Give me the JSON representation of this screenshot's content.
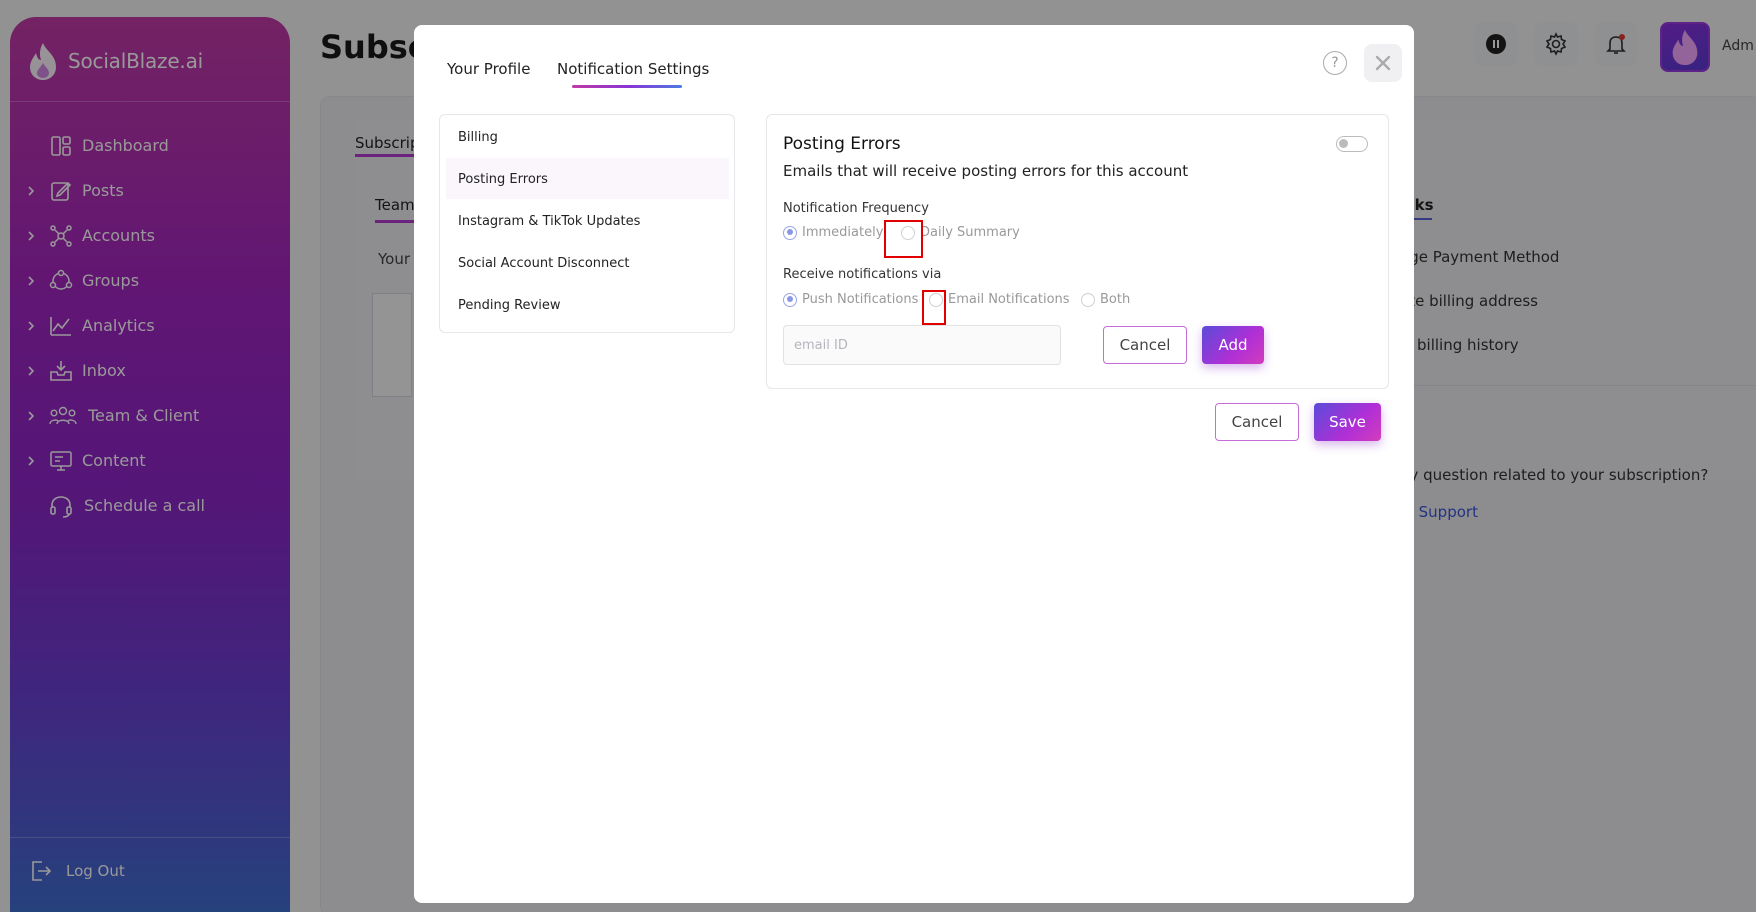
{
  "sidebar": {
    "brand": "SocialBlaze.ai",
    "items": [
      {
        "label": "Dashboard",
        "icon": "dashboard-icon",
        "expandable": false
      },
      {
        "label": "Posts",
        "icon": "posts-icon",
        "expandable": true
      },
      {
        "label": "Accounts",
        "icon": "accounts-icon",
        "expandable": true
      },
      {
        "label": "Groups",
        "icon": "groups-icon",
        "expandable": true
      },
      {
        "label": "Analytics",
        "icon": "analytics-icon",
        "expandable": true
      },
      {
        "label": "Inbox",
        "icon": "inbox-icon",
        "expandable": true
      },
      {
        "label": "Team & Client",
        "icon": "team-icon",
        "expandable": true
      },
      {
        "label": "Content",
        "icon": "content-icon",
        "expandable": true
      },
      {
        "label": "Schedule a call",
        "icon": "headset-icon",
        "expandable": false
      }
    ],
    "logout": "Log Out"
  },
  "background": {
    "page_title": "Subsc",
    "tab": "Subscrip",
    "team_tab": "Team",
    "your_label": "Your",
    "admin_label": "Adm",
    "links_title": "nks",
    "links": [
      "age Payment Method",
      "ate billing address",
      "w billing history"
    ],
    "support_question": "ny question related to your subscription?",
    "support_link": "t Support"
  },
  "modal": {
    "tabs": [
      "Your Profile",
      "Notification Settings"
    ],
    "active_tab": "Notification Settings",
    "help": "?",
    "categories": [
      "Billing",
      "Posting Errors",
      "Instagram & TikTok Updates",
      "Social Account Disconnect",
      "Pending Review"
    ],
    "active_category": "Posting Errors",
    "posting_errors": {
      "title": "Posting Errors",
      "description": "Emails that will receive posting errors for this account",
      "enabled": false,
      "frequency_label": "Notification Frequency",
      "frequency_options": [
        "Immediately",
        "Daily Summary"
      ],
      "frequency_selected": "Immediately",
      "via_label": "Receive notifications via",
      "via_options": [
        "Push Notifications",
        "Email Notifications",
        "Both"
      ],
      "via_selected": "Push Notifications",
      "email_placeholder": "email ID",
      "email_value": "",
      "cancel_label": "Cancel",
      "add_label": "Add"
    },
    "footer": {
      "cancel_label": "Cancel",
      "save_label": "Save"
    }
  },
  "colors": {
    "accent_purple": "#b02fd6",
    "accent_blue": "#5b4bd9",
    "highlight_red": "#e00000"
  }
}
